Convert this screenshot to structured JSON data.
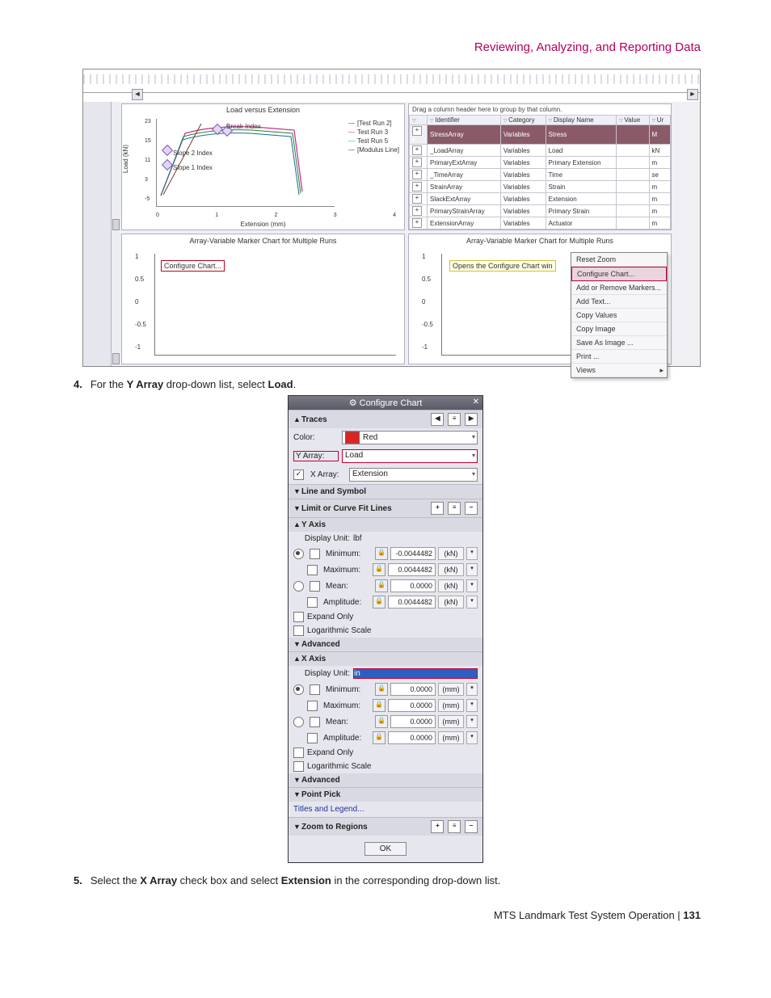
{
  "header": {
    "title": "Reviewing, Analyzing, and Reporting Data"
  },
  "app": {
    "chart": {
      "title": "Load versus Extension",
      "ylabel": "Load (kN)",
      "xlabel": "Extension (mm)",
      "legend": [
        "[Test Run 2]",
        "Test Run 3",
        "Test Run 5",
        "[Modulus Line]"
      ],
      "slope1": "Slope 1 Index",
      "slope2": "Slope 2 Index",
      "break": "Break Index",
      "yticks": [
        "23",
        "15",
        "11",
        "3",
        "-5"
      ],
      "xticks": [
        "0",
        "1",
        "2",
        "3",
        "4"
      ]
    },
    "table": {
      "hint": "Drag a column header here to group by that column.",
      "cols": [
        "Identifier",
        "Category",
        "Display Name",
        "Value",
        "Ur"
      ],
      "rows": [
        {
          "id": "StressArray",
          "cat": "Variables",
          "dn": "Stress",
          "u": "M"
        },
        {
          "id": "_LoadArray",
          "cat": "Variables",
          "dn": "Load",
          "u": "kN"
        },
        {
          "id": "PrimaryExtArray",
          "cat": "Variables",
          "dn": "Primary Extension",
          "u": "m"
        },
        {
          "id": "_TimeArray",
          "cat": "Variables",
          "dn": "Time",
          "u": "se"
        },
        {
          "id": "StrainArray",
          "cat": "Variables",
          "dn": "Strain",
          "u": "m"
        },
        {
          "id": "SlackExtArray",
          "cat": "Variables",
          "dn": "Extension",
          "u": "m"
        },
        {
          "id": "PrimaryStrainArray",
          "cat": "Variables",
          "dn": "Primary Strain",
          "u": "m"
        },
        {
          "id": "ExtensionArray",
          "cat": "Variables",
          "dn": "Actuator",
          "u": "m"
        }
      ]
    },
    "marker_chart_l": {
      "title": "Array-Variable Marker Chart for Multiple Runs",
      "hint": "Configure Chart...",
      "yticks": [
        "1",
        "0.5",
        "0",
        "-0.5",
        "-1"
      ]
    },
    "marker_chart_r": {
      "title": "Array-Variable Marker Chart for Multiple Runs",
      "callout": "Opens the Configure Chart win",
      "yticks": [
        "1",
        "0.5",
        "0",
        "-0.5",
        "-1"
      ]
    },
    "context_menu": {
      "reset": "Reset Zoom",
      "configure": "Configure Chart...",
      "add_markers": "Add or Remove Markers...",
      "add_text": "Add Text...",
      "copy_values": "Copy Values",
      "copy_image": "Copy Image",
      "save_image": "Save As Image ...",
      "print": "Print ...",
      "views": "Views"
    }
  },
  "steps": {
    "s4_num": "4.",
    "s4_a": "For the ",
    "s4_b": "Y Array",
    "s4_c": " drop-down list, select ",
    "s4_d": "Load",
    "s4_e": ".",
    "s5_num": "5.",
    "s5_a": "Select the ",
    "s5_b": "X Array",
    "s5_c": " check box and select ",
    "s5_d": "Extension",
    "s5_e": " in the corresponding drop-down list."
  },
  "dlg": {
    "title": "Configure Chart",
    "traces": "Traces",
    "color": "Color:",
    "color_v": "Red",
    "yarray": "Y Array:",
    "yarray_v": "Load",
    "xarray": "X Array:",
    "xarray_v": "Extension",
    "line_symbol": "Line and Symbol",
    "limit_fit": "Limit or Curve Fit Lines",
    "yaxis": "Y Axis",
    "xaxis": "X Axis",
    "display_unit": "Display Unit:",
    "du_y": "lbf",
    "du_x": "in",
    "minimum": "Minimum:",
    "maximum": "Maximum:",
    "mean": "Mean:",
    "amplitude": "Amplitude:",
    "y_min": "-0.0044482",
    "y_max": "0.0044482",
    "y_mean": "0.0000",
    "y_amp": "0.0044482",
    "y_unit": "(kN)",
    "x_min": "0.0000",
    "x_max": "0.0000",
    "x_mean": "0.0000",
    "x_amp": "0.0000",
    "x_unit": "(mm)",
    "expand": "Expand Only",
    "log": "Logarithmic Scale",
    "advanced": "Advanced",
    "point_pick": "Point Pick",
    "titles_legend": "Titles and Legend...",
    "zoom_regions": "Zoom to Regions",
    "ok": "OK"
  },
  "footer": {
    "text": "MTS Landmark Test System Operation | ",
    "page": "131"
  }
}
